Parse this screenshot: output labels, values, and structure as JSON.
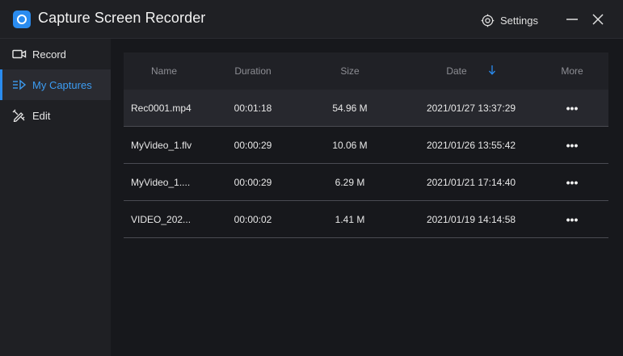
{
  "app": {
    "title": "Capture Screen Recorder",
    "accent": "#2a8cf0"
  },
  "header": {
    "settings_label": "Settings",
    "settings_icon": "gear-icon",
    "minimize_icon": "minimize-icon",
    "close_icon": "close-icon"
  },
  "sidebar": {
    "items": [
      {
        "label": "Record",
        "icon": "camera-icon",
        "active": false
      },
      {
        "label": "My Captures",
        "icon": "playlist-icon",
        "active": true
      },
      {
        "label": "Edit",
        "icon": "edit-tools-icon",
        "active": false
      }
    ]
  },
  "table": {
    "columns": {
      "name": "Name",
      "duration": "Duration",
      "size": "Size",
      "date": "Date",
      "more": "More"
    },
    "sort": {
      "column": "date",
      "direction": "descending",
      "icon": "arrow-down-icon"
    },
    "rows": [
      {
        "name": "Rec0001.mp4",
        "duration": "00:01:18",
        "size": "54.96 M",
        "date": "2021/01/27 13:37:29",
        "more": "•••"
      },
      {
        "name": "MyVideo_1.flv",
        "duration": "00:00:29",
        "size": "10.06 M",
        "date": "2021/01/26 13:55:42",
        "more": "•••"
      },
      {
        "name": "MyVideo_1....",
        "duration": "00:00:29",
        "size": "6.29 M",
        "date": "2021/01/21 17:14:40",
        "more": "•••"
      },
      {
        "name": "VIDEO_202...",
        "duration": "00:00:02",
        "size": "1.41 M",
        "date": "2021/01/19 14:14:58",
        "more": "•••"
      }
    ]
  }
}
